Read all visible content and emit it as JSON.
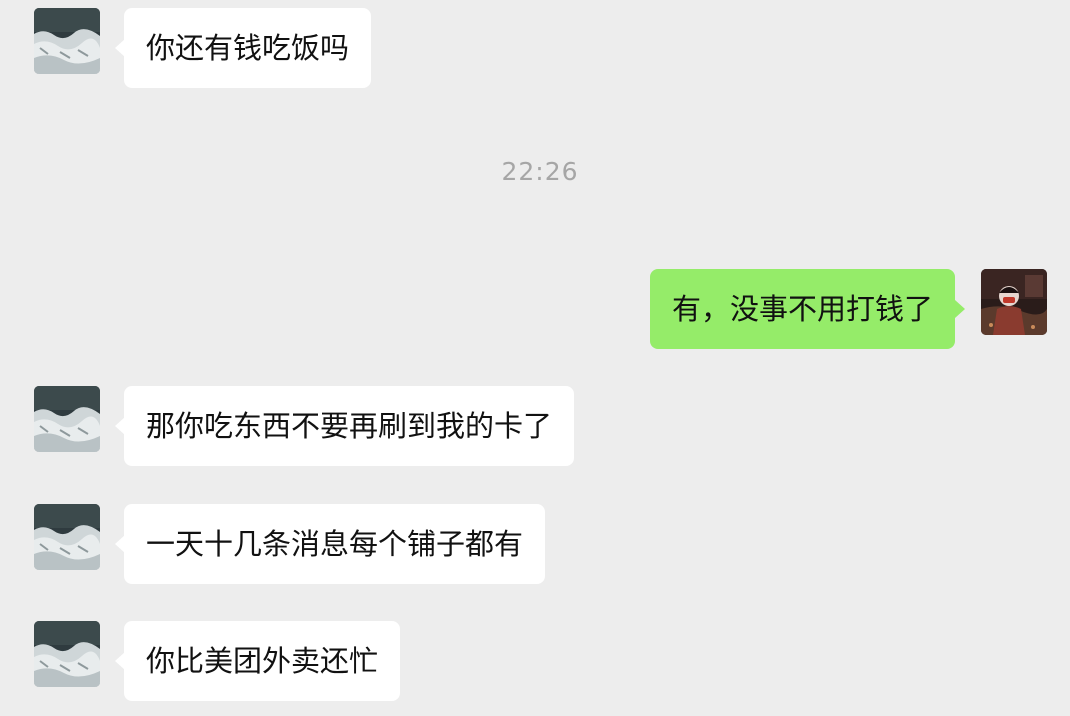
{
  "conversation": {
    "messages": [
      {
        "side": "received",
        "text": "你还有钱吃饭吗"
      },
      {
        "side": "timestamp",
        "text": "22:26"
      },
      {
        "side": "sent",
        "text": "有，没事不用打钱了"
      },
      {
        "side": "received",
        "text": "那你吃东西不要再刷到我的卡了"
      },
      {
        "side": "received",
        "text": "一天十几条消息每个铺子都有"
      },
      {
        "side": "received",
        "text": "你比美团外卖还忙"
      }
    ]
  },
  "colors": {
    "background": "#ededed",
    "received_bubble": "#ffffff",
    "sent_bubble": "#95ec69",
    "timestamp_text": "#a6a6a6"
  },
  "icons": {
    "contact_avatar": "ocean-wave-avatar",
    "self_avatar": "person-photo-avatar"
  }
}
